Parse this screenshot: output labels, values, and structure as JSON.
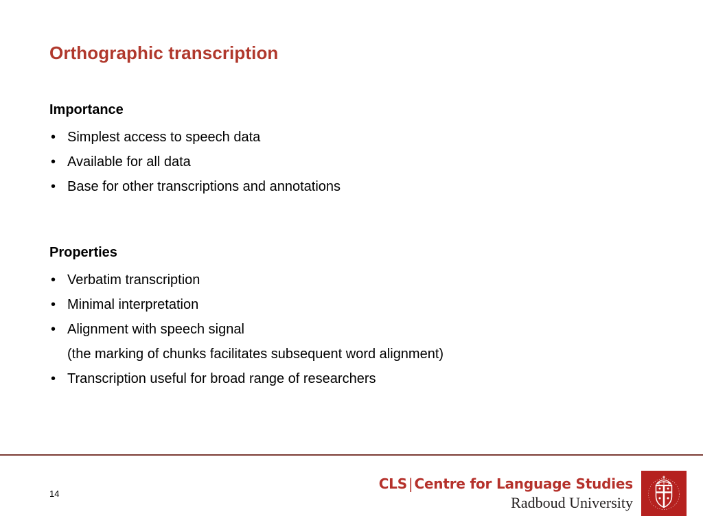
{
  "slide": {
    "title": "Orthographic transcription",
    "page_number": "14",
    "bullet_glyph": "•",
    "accent_color": "#B0382C",
    "divider_color": "#7B3B33",
    "background_color": "#FFFFFF",
    "sections": [
      {
        "heading": "Importance",
        "bullets": [
          {
            "text": "Simplest access to speech data"
          },
          {
            "text": "Available for all data"
          },
          {
            "text": "Base for other transcriptions and annotations"
          }
        ]
      },
      {
        "heading": "Properties",
        "bullets": [
          {
            "text": "Verbatim transcription"
          },
          {
            "text": "Minimal interpretation"
          },
          {
            "text": "Alignment with speech signal",
            "subline": "(the marking of chunks facilitates subsequent word alignment)"
          },
          {
            "text": "Transcription useful for broad range of researchers"
          }
        ]
      }
    ]
  },
  "footer": {
    "brand_abbrev": "CLS",
    "brand_separator": "|",
    "brand_name": "Centre for Language Studies",
    "brand_institution": "Radboud University",
    "brand_color": "#B5312B",
    "logo_color": "#B5211F",
    "logo_icon": "radboud-shield-icon"
  }
}
